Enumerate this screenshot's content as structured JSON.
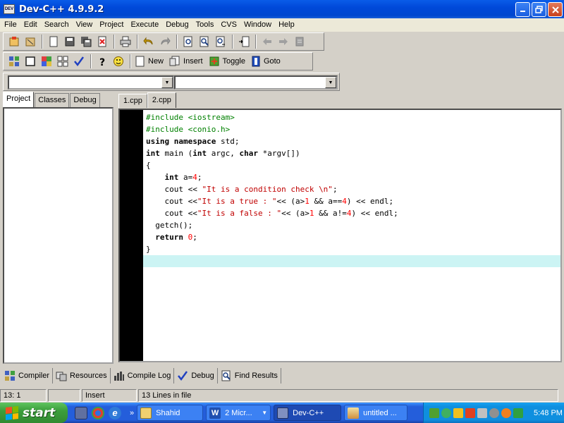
{
  "window": {
    "title": "Dev-C++ 4.9.9.2",
    "app_icon_label": "DEV"
  },
  "menu": [
    "File",
    "Edit",
    "Search",
    "View",
    "Project",
    "Execute",
    "Debug",
    "Tools",
    "CVS",
    "Window",
    "Help"
  ],
  "toolbar2": {
    "new_label": "New",
    "insert_label": "Insert",
    "toggle_label": "Toggle",
    "goto_label": "Goto"
  },
  "left_tabs": [
    "Project",
    "Classes",
    "Debug"
  ],
  "editor_tabs": [
    "1.cpp",
    "2.cpp"
  ],
  "code_lines": [
    "#include <iostream>",
    "#include <conio.h>",
    "using namespace std;",
    "int main (int argc, char *argv[])",
    "{",
    "    int a=4;",
    "    cout << \"It is a condition check \\n\";",
    "    cout <<\"It is a true : \"<< (a>1 && a==4) << endl;",
    "    cout <<\"It is a false : \"<< (a>1 && a!=4) << endl;",
    "  getch();",
    "  return 0;",
    "}",
    ""
  ],
  "bottom_tabs": [
    "Compiler",
    "Resources",
    "Compile Log",
    "Debug",
    "Find Results"
  ],
  "status": {
    "position": "13: 1",
    "mode": "Insert",
    "lines": "13 Lines in file"
  },
  "taskbar": {
    "start_label": "start",
    "tasks": [
      "Shahid",
      "2 Micr...",
      "Dev-C++",
      "untitled ..."
    ],
    "clock": "5:48 PM"
  }
}
